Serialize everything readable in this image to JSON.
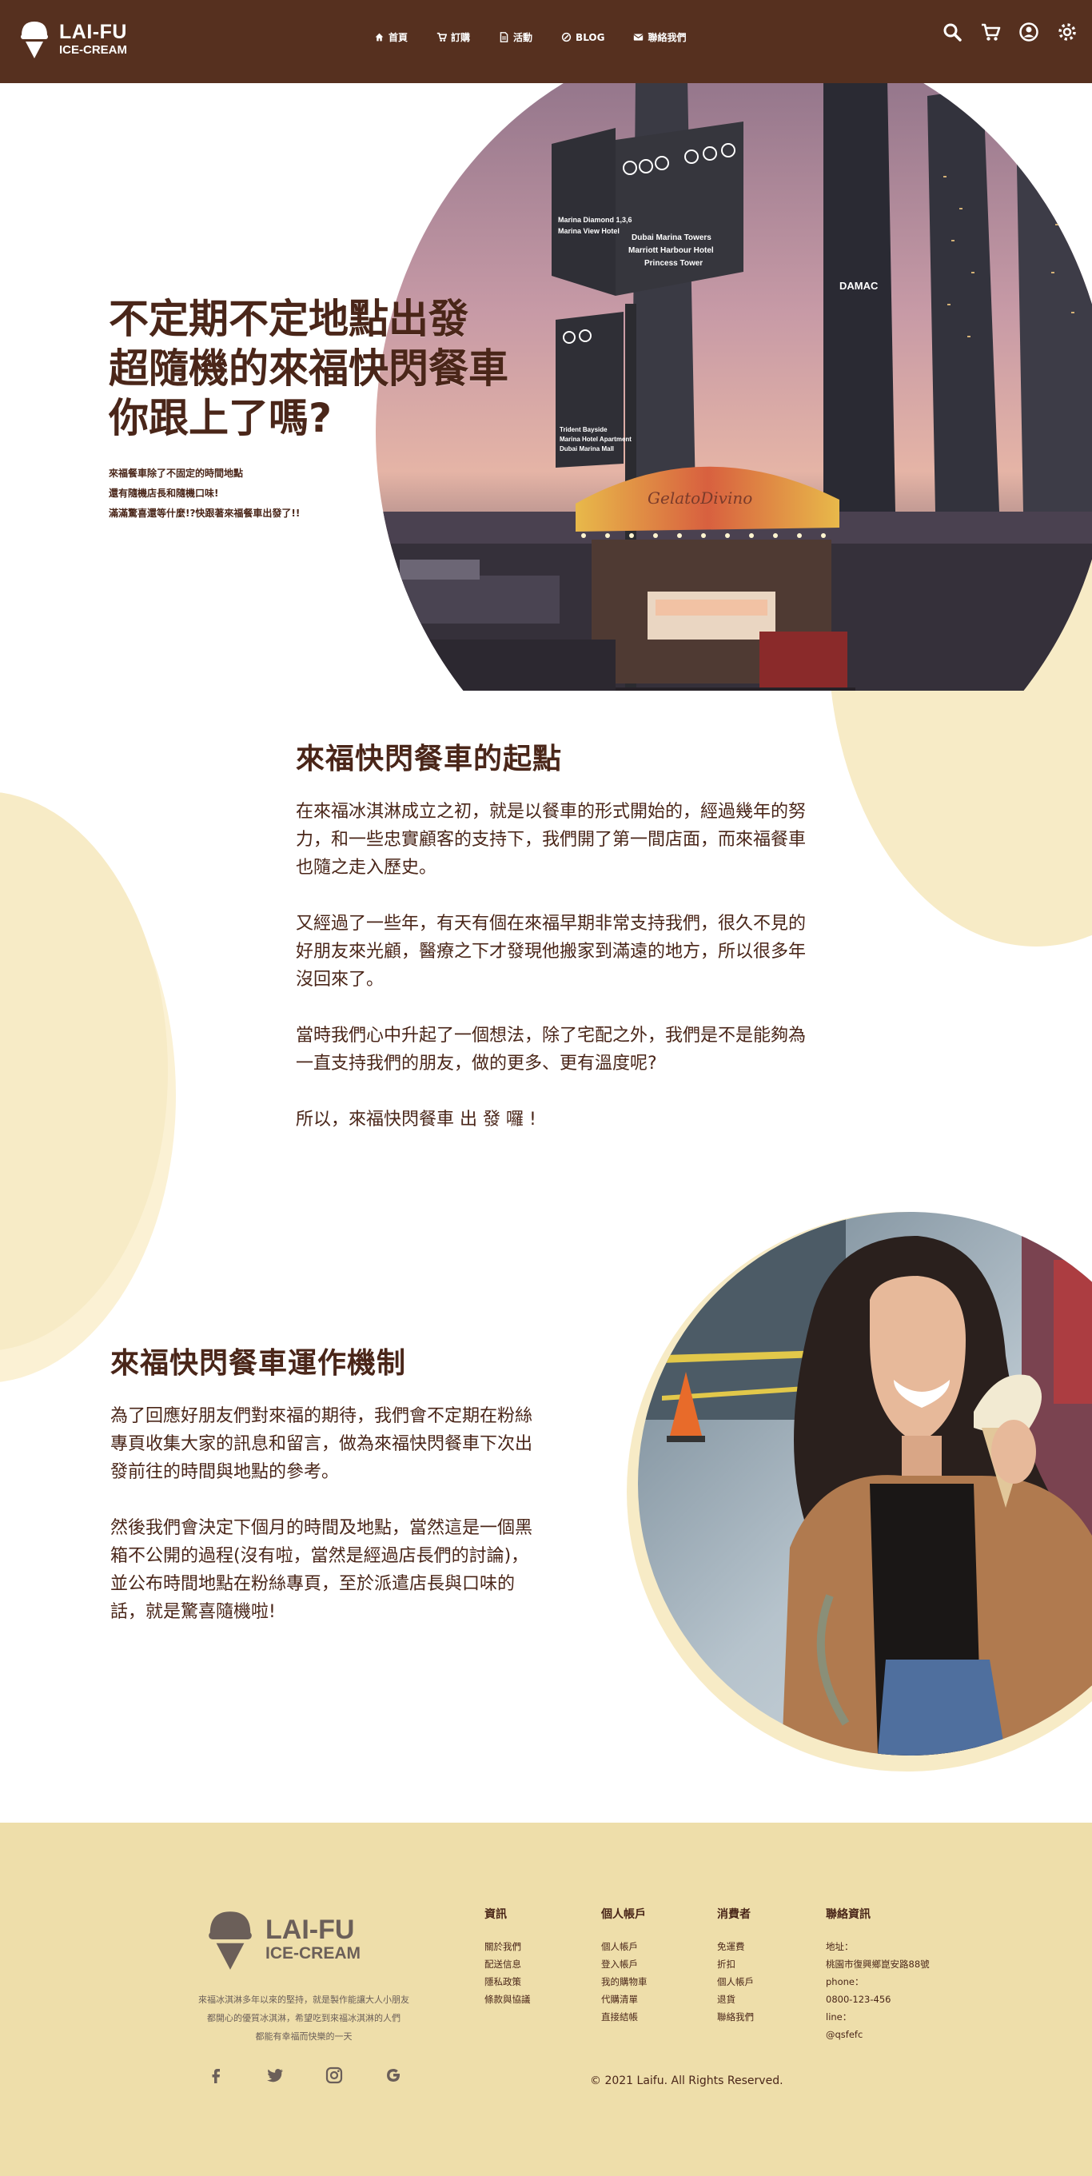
{
  "brand": {
    "name": "LAI-FU",
    "tagline": "ICE-CREAM"
  },
  "nav": [
    {
      "label": "首頁",
      "icon": "home-icon"
    },
    {
      "label": "訂購",
      "icon": "cart-icon"
    },
    {
      "label": "活動",
      "icon": "document-icon"
    },
    {
      "label": "BLOG",
      "icon": "blog-icon"
    },
    {
      "label": "聯絡我們",
      "icon": "mail-icon"
    }
  ],
  "header_icons": [
    "search-icon",
    "cart-icon",
    "user-icon",
    "settings-icon"
  ],
  "hero": {
    "title_lines": [
      "不定期不定地點出發",
      "超隨機的來福快閃餐車",
      "你跟上了嗎?"
    ],
    "sub_lines": [
      "來福餐車除了不固定的時間地點",
      "還有隨機店長和隨機口味!",
      "滿滿驚喜還等什麼!?快跟著來福餐車出發了!!"
    ],
    "sign_text": [
      "Dubai Marina Towers",
      "Marriott Harbour Hotel",
      "Princess Tower",
      "Marina Diamond 1,3,6",
      "Marina View Hotel",
      "Trident Bayside",
      "Marina Hotel Apartment",
      "Dubai Marina Mall"
    ],
    "shop_text": "GelatoDivino",
    "building_text": "DAMAC"
  },
  "origin": {
    "title": "來福快閃餐車的起點",
    "paragraphs": [
      "在來福冰淇淋成立之初，就是以餐車的形式開始的，經過幾年的努力，和一些忠實顧客的支持下，我們開了第一間店面，而來福餐車也隨之走入歷史。",
      "又經過了一些年，有天有個在來福早期非常支持我們，很久不見的好朋友來光顧，醫療之下才發現他搬家到滿遠的地方，所以很多年沒回來了。",
      "當時我們心中升起了一個想法，除了宅配之外，我們是不是能夠為一直支持我們的朋友，做的更多、更有溫度呢?",
      "所以，來福快閃餐車 出 發 囉 !"
    ]
  },
  "mechanism": {
    "title": "來福快閃餐車運作機制",
    "paragraphs": [
      "為了回應好朋友們對來福的期待，我們會不定期在粉絲專頁收集大家的訊息和留言，做為來福快閃餐車下次出發前往的時間與地點的參考。",
      "然後我們會決定下個月的時間及地點，當然這是一個黑箱不公開的過程(沒有啦，當然是經過店長們的討論)，並公布時間地點在粉絲專頁，至於派遣店長與口味的話，就是驚喜隨機啦!"
    ]
  },
  "footer": {
    "desc_lines": [
      "來福冰淇淋多年以來的堅持，就是製作能讓大人小朋友",
      "都開心的優質冰淇淋，希望吃到來福冰淇淋的人們",
      "都能有幸福而快樂的一天"
    ],
    "social": [
      "facebook-icon",
      "twitter-icon",
      "instagram-icon",
      "google-icon"
    ],
    "columns": [
      {
        "title": "資訊",
        "links": [
          "關於我們",
          "配送信息",
          "隱私政策",
          "條款與協議"
        ]
      },
      {
        "title": "個人帳戶",
        "links": [
          "個人帳戶",
          "登入帳戶",
          "我的購物車",
          "代購清單",
          "直接結帳"
        ]
      },
      {
        "title": "消費者",
        "links": [
          "免運費",
          "折扣",
          "個人帳戶",
          "退貨",
          "聯絡我們"
        ]
      },
      {
        "title": "聯絡資訊",
        "lines": [
          "地址：",
          "桃園市復興鄉崑安路88號",
          "phone：",
          "0800-123-456",
          "line：",
          "@qsfefc"
        ]
      }
    ],
    "copyright": "© 2021 Laifu.  All Rights Reserved."
  },
  "colors": {
    "header": "#56301f",
    "text": "#4a2619",
    "cream": "#f7ebc6",
    "footer": "#eedeaa",
    "footer_text": "#6b5f59"
  }
}
